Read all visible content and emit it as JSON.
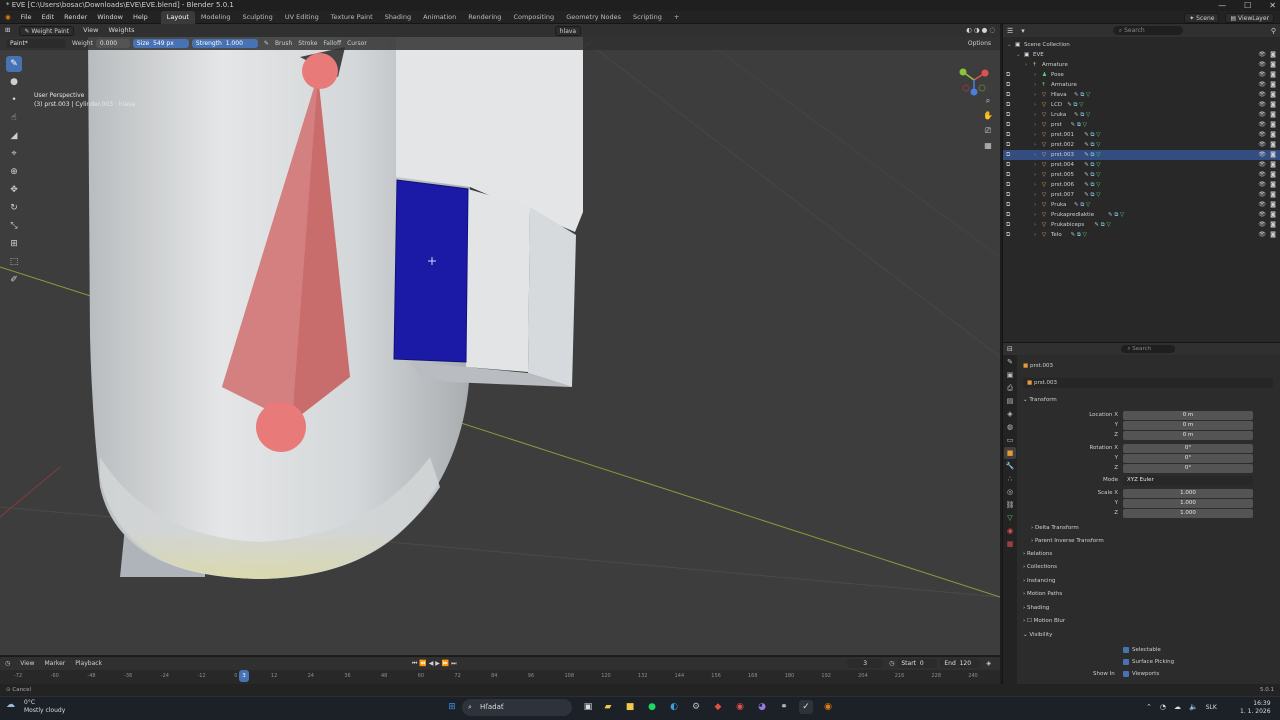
{
  "window": {
    "title": "* EVE [C:\\Users\\bosac\\Downloads\\EVE\\EVE.blend] - Blender 5.0.1",
    "controls": [
      "—",
      "☐",
      "✕"
    ]
  },
  "menu": {
    "items": [
      "File",
      "Edit",
      "Render",
      "Window",
      "Help"
    ],
    "workspaces": [
      "Layout",
      "Modeling",
      "Sculpting",
      "UV Editing",
      "Texture Paint",
      "Shading",
      "Animation",
      "Rendering",
      "Compositing",
      "Geometry Nodes",
      "Scripting",
      "+"
    ],
    "active_workspace": "Layout",
    "scene": "Scene",
    "view_layer": "ViewLayer"
  },
  "viewport_header": {
    "mode": "Weight Paint",
    "items": [
      "View",
      "Weights"
    ],
    "vertex_group": "hlava",
    "options_label": "Options"
  },
  "tool_settings": {
    "brush_dropdown": "Paint*",
    "weight_label": "Weight",
    "weight_value": "0.000",
    "size_label": "Size",
    "size_value": "549 px",
    "strength_label": "Strength",
    "strength_value": "1.000",
    "menus": [
      "Brush",
      "Stroke",
      "Falloff",
      "Cursor"
    ]
  },
  "viewport": {
    "perspective": "User Perspective",
    "object_info": "(3) prst.003 | Cylinder.003 : hlava"
  },
  "toolbar": {
    "tools": [
      "draw-tool",
      "blur-tool",
      "average-tool",
      "smear-tool",
      "gradient-tool",
      "sample-tool",
      "annotate-tool",
      "cursor-tool",
      "move-tool",
      "rotate-tool",
      "scale-tool",
      "transform-tool",
      "select-box-tool",
      "measure-tool"
    ]
  },
  "outliner": {
    "search_placeholder": "Search",
    "items": [
      {
        "name": "Scene Collection",
        "level": 0,
        "type": "collection"
      },
      {
        "name": "EVE",
        "level": 1,
        "type": "collection"
      },
      {
        "name": "Armature",
        "level": 2,
        "type": "armature"
      },
      {
        "name": "Pose",
        "level": 3,
        "type": "pose"
      },
      {
        "name": "Armature",
        "level": 3,
        "type": "armature-data"
      },
      {
        "name": "Hlava",
        "level": 3,
        "type": "mesh"
      },
      {
        "name": "LCD",
        "level": 3,
        "type": "mesh"
      },
      {
        "name": "Lruka",
        "level": 3,
        "type": "mesh"
      },
      {
        "name": "prst",
        "level": 3,
        "type": "mesh"
      },
      {
        "name": "prst.001",
        "level": 3,
        "type": "mesh"
      },
      {
        "name": "prst.002",
        "level": 3,
        "type": "mesh"
      },
      {
        "name": "prst.003",
        "level": 3,
        "type": "mesh",
        "selected": true
      },
      {
        "name": "prst.004",
        "level": 3,
        "type": "mesh"
      },
      {
        "name": "prst.005",
        "level": 3,
        "type": "mesh"
      },
      {
        "name": "prst.006",
        "level": 3,
        "type": "mesh"
      },
      {
        "name": "prst.007",
        "level": 3,
        "type": "mesh"
      },
      {
        "name": "Pruka",
        "level": 3,
        "type": "mesh"
      },
      {
        "name": "Prukapredlaktie",
        "level": 3,
        "type": "mesh"
      },
      {
        "name": "Prukabiceps",
        "level": 3,
        "type": "mesh"
      },
      {
        "name": "Telo",
        "level": 3,
        "type": "mesh"
      }
    ]
  },
  "properties": {
    "search_placeholder": "Search",
    "breadcrumb": "prst.003",
    "object_name": "prst.003",
    "transform_label": "Transform",
    "location": {
      "label": "Location X",
      "x": "0 m",
      "y": "0 m",
      "z": "0 m"
    },
    "rotation": {
      "label": "Rotation X",
      "x": "0°",
      "y": "0°",
      "z": "0°"
    },
    "mode_label": "Mode",
    "mode_value": "XYZ Euler",
    "scale": {
      "label": "Scale X",
      "x": "1.000",
      "y": "1.000",
      "z": "1.000"
    },
    "axis_labels": [
      "Y",
      "Z"
    ],
    "sections": [
      "Delta Transform",
      "Parent Inverse Transform",
      "Relations",
      "Collections",
      "Instancing",
      "Motion Paths",
      "Shading",
      "Motion Blur",
      "Visibility"
    ],
    "visibility": {
      "selectable": "Selectable",
      "surface_picking": "Surface Picking",
      "show_in_label": "Show In",
      "viewports": "Viewports"
    }
  },
  "timeline": {
    "menus": [
      "View",
      "Marker",
      "Playback"
    ],
    "current_frame": "3",
    "start_label": "Start",
    "start": "0",
    "end_label": "End",
    "end": "120",
    "ticks": [
      "-72",
      "-60",
      "-48",
      "-36",
      "-24",
      "-12",
      "0",
      "12",
      "24",
      "36",
      "48",
      "60",
      "72",
      "84",
      "96",
      "108",
      "120",
      "132",
      "144",
      "156",
      "168",
      "180",
      "192",
      "204",
      "216",
      "228",
      "240"
    ]
  },
  "statusbar": {
    "left": "Cancel",
    "version": "5.0.1"
  },
  "taskbar": {
    "weather_temp": "0°C",
    "weather_text": "Mostly cloudy",
    "search_placeholder": "Hľadať",
    "language": "SLK",
    "time": "16:39",
    "date": "1. 1. 2026"
  },
  "colors": {
    "accent": "#4772b3",
    "selected_row": "#334d80",
    "bone": "#c96c6c",
    "weight_zero": "#1a1aa6"
  }
}
